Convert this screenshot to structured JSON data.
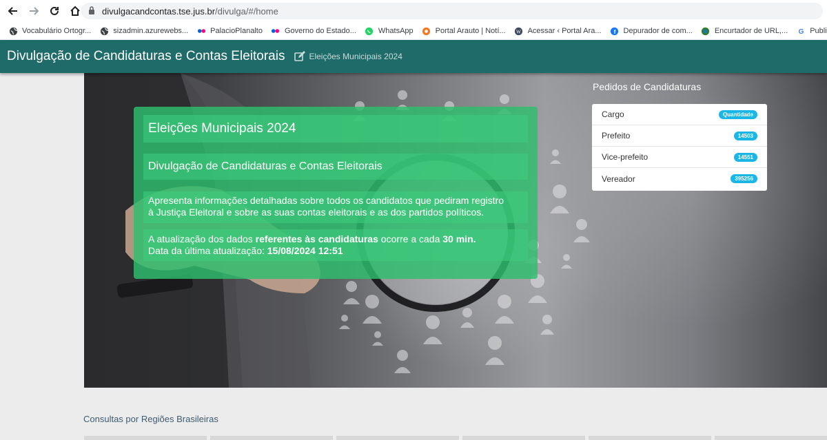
{
  "browser": {
    "url_domain": "divulgacandcontas.tse.jus.br",
    "url_path": "/divulga/#/home",
    "bookmarks": [
      {
        "label": "Vocabulário Ortogr...",
        "icon": "globe-icon"
      },
      {
        "label": "sizadmin.azurewebs...",
        "icon": "globe-icon"
      },
      {
        "label": "PalacioPlanalto",
        "icon": "flickr-icon"
      },
      {
        "label": "Governo do Estado...",
        "icon": "flickr-icon"
      },
      {
        "label": "WhatsApp",
        "icon": "whatsapp-icon"
      },
      {
        "label": "Portal Arauto | Notí...",
        "icon": "arauto-icon"
      },
      {
        "label": "Acessar ‹ Portal Ara...",
        "icon": "wordpress-icon"
      },
      {
        "label": "Depurador de com...",
        "icon": "facebook-icon"
      },
      {
        "label": "Encurtador de URL,...",
        "icon": "link-icon"
      },
      {
        "label": "Publisher Center",
        "icon": "google-icon"
      }
    ]
  },
  "header": {
    "title": "Divulgação de Candidaturas e Contas Eleitorais",
    "subtitle": "Eleições Municipais 2024",
    "color": "#1e6b6a"
  },
  "hero": {
    "title": "Eleições Municipais 2024",
    "subtitle": "Divulgação de Candidaturas e Contas Eleitorais",
    "description_line1": "Apresenta informações detalhadas sobre todos os candidatos que pediram registro",
    "description_line2": "à Justiça Eleitoral e sobre as suas contas eleitorais e as dos partidos políticos.",
    "update_prefix": "A atualização dos dados ",
    "update_bold": "referentes às candidaturas",
    "update_mid": " ocorre a cada ",
    "update_interval": "30 min.",
    "last_update_label": "Data da última atualização: ",
    "last_update_value": "15/08/2024 12:51",
    "card_color": "#2ebe6e"
  },
  "pedidos": {
    "title": "Pedidos de Candidaturas",
    "header_label": "Cargo",
    "header_badge": "Quantidade",
    "rows": [
      {
        "label": "Prefeito",
        "count": "14503"
      },
      {
        "label": "Vice-prefeito",
        "count": "14551"
      },
      {
        "label": "Vereador",
        "count": "395256"
      }
    ],
    "badge_color": "#19b6e6"
  },
  "regions": {
    "title": "Consultas por Regiões Brasileiras"
  }
}
